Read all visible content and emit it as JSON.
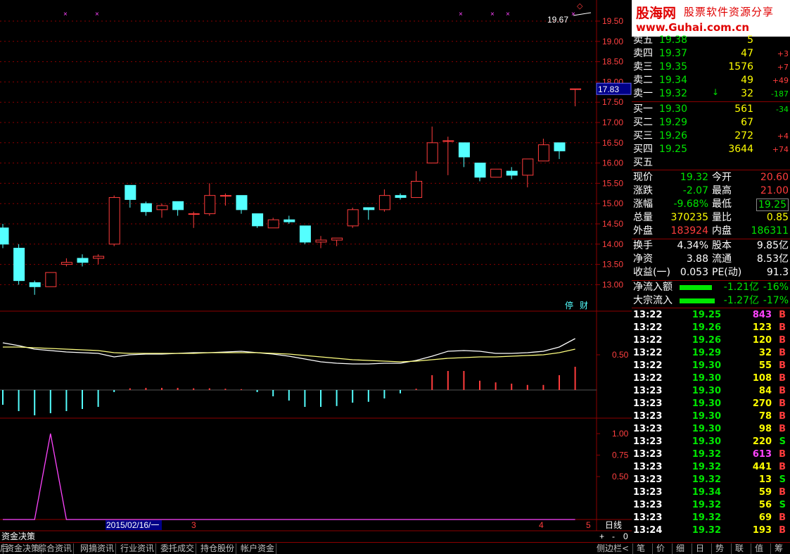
{
  "banner": {
    "logo_left": "股海网",
    "logo_right": "股票软件资源分享",
    "url": "www.Guhai.com.cn"
  },
  "order_book": {
    "asks": [
      {
        "label": "卖五",
        "price": "19.38",
        "vol": "5",
        "chg": ""
      },
      {
        "label": "卖四",
        "price": "19.37",
        "vol": "47",
        "chg": "+3"
      },
      {
        "label": "卖三",
        "price": "19.35",
        "vol": "1576",
        "chg": "+7"
      },
      {
        "label": "卖二",
        "price": "19.34",
        "vol": "49",
        "chg": "+49"
      },
      {
        "label": "卖一",
        "price": "19.32",
        "vol": "32",
        "chg": "-187"
      }
    ],
    "bids": [
      {
        "label": "买一",
        "price": "19.30",
        "vol": "561",
        "chg": "-34"
      },
      {
        "label": "买二",
        "price": "19.29",
        "vol": "67",
        "chg": ""
      },
      {
        "label": "买三",
        "price": "19.26",
        "vol": "272",
        "chg": "+4"
      },
      {
        "label": "买四",
        "price": "19.25",
        "vol": "3644",
        "chg": "+74"
      },
      {
        "label": "买五",
        "price": "",
        "vol": "",
        "chg": ""
      }
    ]
  },
  "quote": {
    "xianjia_label": "现价",
    "xianjia": "19.32",
    "jinkai_label": "今开",
    "jinkai": "20.60",
    "zhangdie_label": "涨跌",
    "zhangdie": "-2.07",
    "zuigao_label": "最高",
    "zuigao": "21.00",
    "zhangfu_label": "涨幅",
    "zhangfu": "-9.68%",
    "zuidi_label": "最低",
    "zuidi": "19.25",
    "zongliang_label": "总量",
    "zongliang": "370235",
    "liangbi_label": "量比",
    "liangbi": "0.85",
    "waipan_label": "外盘",
    "waipan": "183924",
    "neipan_label": "内盘",
    "neipan": "186311"
  },
  "fundamentals": {
    "huanshou_label": "换手",
    "huanshou": "4.34%",
    "guben_label": "股本",
    "guben": "9.85亿",
    "jingzi_label": "净资",
    "jingzi": "3.88",
    "liutong_label": "流通",
    "liutong": "8.53亿",
    "shouyi_label": "收益(一)",
    "shouyi": "0.053",
    "pe_label": "PE(动)",
    "pe": "91.3"
  },
  "flows": [
    {
      "label": "净流入额",
      "value": "-1.21亿",
      "pct": "-16%"
    },
    {
      "label": "大宗流入",
      "value": "-1.27亿",
      "pct": "-17%"
    }
  ],
  "trades": [
    {
      "time": "13:22",
      "price": "19.25",
      "vol": "843",
      "side": "B",
      "color": "#ff44ff"
    },
    {
      "time": "13:22",
      "price": "19.26",
      "vol": "123",
      "side": "B",
      "color": "#ffff00"
    },
    {
      "time": "13:22",
      "price": "19.26",
      "vol": "120",
      "side": "B",
      "color": "#ffff00"
    },
    {
      "time": "13:22",
      "price": "19.29",
      "vol": "32",
      "side": "B",
      "color": "#ffff00"
    },
    {
      "time": "13:22",
      "price": "19.30",
      "vol": "55",
      "side": "B",
      "color": "#ffff00"
    },
    {
      "time": "13:22",
      "price": "19.30",
      "vol": "108",
      "side": "B",
      "color": "#ffff00"
    },
    {
      "time": "13:23",
      "price": "19.30",
      "vol": "84",
      "side": "B",
      "color": "#ffff00"
    },
    {
      "time": "13:23",
      "price": "19.30",
      "vol": "270",
      "side": "B",
      "color": "#ffff00"
    },
    {
      "time": "13:23",
      "price": "19.30",
      "vol": "78",
      "side": "B",
      "color": "#ffff00"
    },
    {
      "time": "13:23",
      "price": "19.30",
      "vol": "98",
      "side": "B",
      "color": "#ffff00"
    },
    {
      "time": "13:23",
      "price": "19.30",
      "vol": "220",
      "side": "S",
      "color": "#ffff00"
    },
    {
      "time": "13:23",
      "price": "19.32",
      "vol": "613",
      "side": "B",
      "color": "#ff44ff"
    },
    {
      "time": "13:23",
      "price": "19.32",
      "vol": "441",
      "side": "B",
      "color": "#ffff00"
    },
    {
      "time": "13:23",
      "price": "19.32",
      "vol": "13",
      "side": "S",
      "color": "#ffff00"
    },
    {
      "time": "13:23",
      "price": "19.34",
      "vol": "59",
      "side": "B",
      "color": "#ffff00"
    },
    {
      "time": "13:23",
      "price": "19.32",
      "vol": "56",
      "side": "S",
      "color": "#ffff00"
    },
    {
      "time": "13:23",
      "price": "19.32",
      "vol": "69",
      "side": "B",
      "color": "#ffff00"
    },
    {
      "time": "13:24",
      "price": "19.32",
      "vol": "193",
      "side": "B",
      "color": "#ffff00"
    }
  ],
  "chart": {
    "price_ticks": [
      "19.50",
      "19.00",
      "18.50",
      "18.00",
      "17.50",
      "17.00",
      "16.50",
      "16.00",
      "15.50",
      "15.00",
      "14.50",
      "14.00",
      "13.50",
      "13.00"
    ],
    "current_price_label": "17.83",
    "high_label": "19.67",
    "tags": [
      "停",
      "财"
    ],
    "macd_tick": "0.50",
    "sub_ticks": [
      "1.00",
      "0.75",
      "0.50"
    ],
    "date_label": "2015/02/16/一",
    "marker_3": "3",
    "marker_4": "4",
    "marker_5": "5",
    "period_label": "日线",
    "zoom_plus": "+",
    "zoom_minus": "-",
    "zoom_value": "0",
    "candles": [
      {
        "o": 14.4,
        "h": 14.5,
        "l": 13.9,
        "c": 14.0
      },
      {
        "o": 13.9,
        "h": 14.0,
        "l": 13.0,
        "c": 13.1
      },
      {
        "o": 13.05,
        "h": 13.1,
        "l": 12.75,
        "c": 12.95
      },
      {
        "o": 12.95,
        "h": 13.3,
        "l": 12.95,
        "c": 13.3
      },
      {
        "o": 13.5,
        "h": 13.65,
        "l": 13.45,
        "c": 13.55
      },
      {
        "o": 13.65,
        "h": 13.75,
        "l": 13.45,
        "c": 13.55
      },
      {
        "o": 13.65,
        "h": 13.75,
        "l": 13.5,
        "c": 13.7
      },
      {
        "o": 14.0,
        "h": 15.2,
        "l": 13.95,
        "c": 15.15
      },
      {
        "o": 15.45,
        "h": 15.45,
        "l": 14.9,
        "c": 15.1
      },
      {
        "o": 15.0,
        "h": 15.05,
        "l": 14.7,
        "c": 14.8
      },
      {
        "o": 14.85,
        "h": 15.0,
        "l": 14.65,
        "c": 14.95
      },
      {
        "o": 15.05,
        "h": 15.05,
        "l": 14.7,
        "c": 14.85
      },
      {
        "o": 14.75,
        "h": 14.8,
        "l": 14.4,
        "c": 14.75
      },
      {
        "o": 14.75,
        "h": 15.5,
        "l": 14.7,
        "c": 15.2
      },
      {
        "o": 15.2,
        "h": 15.25,
        "l": 14.95,
        "c": 15.2
      },
      {
        "o": 15.2,
        "h": 15.2,
        "l": 14.75,
        "c": 14.85
      },
      {
        "o": 14.75,
        "h": 14.75,
        "l": 14.4,
        "c": 14.45
      },
      {
        "o": 14.4,
        "h": 14.65,
        "l": 14.4,
        "c": 14.6
      },
      {
        "o": 14.6,
        "h": 14.7,
        "l": 14.5,
        "c": 14.55
      },
      {
        "o": 14.45,
        "h": 14.45,
        "l": 14.0,
        "c": 14.05
      },
      {
        "o": 14.05,
        "h": 14.2,
        "l": 13.9,
        "c": 14.1
      },
      {
        "o": 14.1,
        "h": 14.15,
        "l": 13.95,
        "c": 14.15
      },
      {
        "o": 14.45,
        "h": 14.9,
        "l": 14.4,
        "c": 14.85
      },
      {
        "o": 14.9,
        "h": 14.9,
        "l": 14.6,
        "c": 14.85
      },
      {
        "o": 14.85,
        "h": 15.35,
        "l": 14.8,
        "c": 15.2
      },
      {
        "o": 15.2,
        "h": 15.25,
        "l": 15.1,
        "c": 15.15
      },
      {
        "o": 15.15,
        "h": 15.8,
        "l": 15.15,
        "c": 15.55
      },
      {
        "o": 16.0,
        "h": 16.9,
        "l": 16.0,
        "c": 16.5
      },
      {
        "o": 16.55,
        "h": 16.65,
        "l": 15.7,
        "c": 16.55
      },
      {
        "o": 16.5,
        "h": 16.5,
        "l": 15.9,
        "c": 16.15
      },
      {
        "o": 16.0,
        "h": 16.0,
        "l": 15.55,
        "c": 15.65
      },
      {
        "o": 15.65,
        "h": 15.85,
        "l": 15.65,
        "c": 15.85
      },
      {
        "o": 15.8,
        "h": 15.9,
        "l": 15.6,
        "c": 15.7
      },
      {
        "o": 15.7,
        "h": 16.1,
        "l": 15.4,
        "c": 16.1
      },
      {
        "o": 16.05,
        "h": 16.6,
        "l": 16.05,
        "c": 16.45
      },
      {
        "o": 16.5,
        "h": 16.5,
        "l": 16.1,
        "c": 16.3
      },
      {
        "o": 17.83,
        "h": 17.83,
        "l": 17.4,
        "c": 17.83
      }
    ],
    "macd_hist": [
      -0.35,
      -0.5,
      -0.6,
      -0.55,
      -0.5,
      -0.45,
      -0.4,
      -0.05,
      0.04,
      0.05,
      0.05,
      0.05,
      0.04,
      0.04,
      0.03,
      0.02,
      -0.05,
      -0.15,
      -0.25,
      -0.4,
      -0.4,
      -0.38,
      -0.3,
      -0.28,
      -0.2,
      -0.08,
      0.03,
      0.35,
      0.45,
      0.45,
      0.22,
      0.18,
      0.15,
      0.12,
      0.12,
      0.35,
      0.55
    ],
    "diff": [
      0.67,
      0.63,
      0.58,
      0.56,
      0.54,
      0.53,
      0.52,
      0.47,
      0.5,
      0.51,
      0.51,
      0.52,
      0.53,
      0.53,
      0.54,
      0.55,
      0.53,
      0.51,
      0.48,
      0.44,
      0.4,
      0.38,
      0.37,
      0.37,
      0.38,
      0.38,
      0.42,
      0.48,
      0.55,
      0.56,
      0.55,
      0.52,
      0.52,
      0.53,
      0.55,
      0.61,
      0.73
    ],
    "dea": [
      0.61,
      0.61,
      0.6,
      0.59,
      0.58,
      0.57,
      0.56,
      0.53,
      0.52,
      0.52,
      0.52,
      0.52,
      0.52,
      0.53,
      0.53,
      0.53,
      0.53,
      0.52,
      0.51,
      0.49,
      0.47,
      0.45,
      0.43,
      0.42,
      0.41,
      0.4,
      0.41,
      0.43,
      0.45,
      0.46,
      0.47,
      0.47,
      0.48,
      0.49,
      0.5,
      0.53,
      0.58
    ],
    "sub_line": [
      0,
      0,
      0,
      1,
      0,
      0,
      0,
      0,
      0,
      0,
      0,
      0,
      0,
      0,
      0,
      0,
      0,
      0,
      0,
      0,
      0,
      0,
      0,
      0,
      0,
      0,
      0,
      0,
      0,
      0,
      0,
      0,
      0,
      0,
      0,
      0,
      0
    ],
    "colors": {
      "up": "#ff3c3c",
      "down": "#54ffff",
      "grid": "#8b0000",
      "diff": "#ffffff",
      "dea": "#ffff80",
      "sub": "#ff44ff"
    }
  },
  "bottom_tabs": [
    "资金决策",
    "综合资讯",
    "网摘资讯",
    "行业资讯",
    "委托成交",
    "持仓股份",
    "帐户资金"
  ],
  "bottom_tabs_prefix": "后",
  "side_toggle": "侧边栏<",
  "right_tabs": [
    "笔",
    "价",
    "细",
    "日",
    "势",
    "联",
    "值",
    "筹"
  ]
}
